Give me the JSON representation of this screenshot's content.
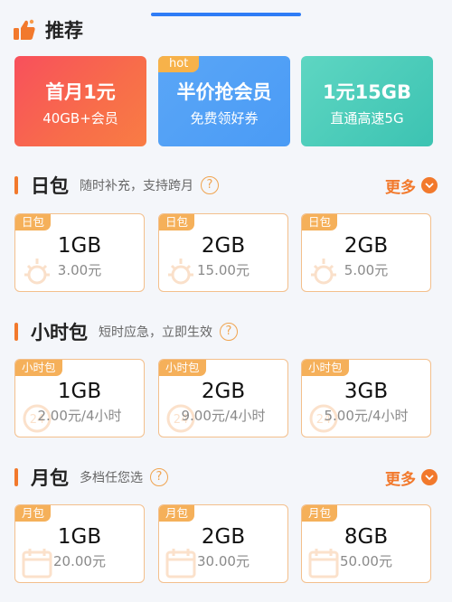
{
  "recommend": {
    "title": "推荐",
    "cards": [
      {
        "main": "首月1元",
        "sub": "40GB+会员"
      },
      {
        "main": "半价抢会员",
        "sub": "免费领好券",
        "tag": "hot"
      },
      {
        "main": "1元15GB",
        "sub": "直通高速5G"
      }
    ]
  },
  "colors": {
    "accent": "#f2792c",
    "tab_indicator": "#2e7cf6"
  },
  "sections": [
    {
      "name": "日包",
      "desc": "随时补充，支持跨月",
      "help": "?",
      "more": "更多",
      "icon": "sun-icon",
      "packages": [
        {
          "tag": "日包",
          "amount": "1GB",
          "price": "3.00元"
        },
        {
          "tag": "日包",
          "amount": "2GB",
          "price": "15.00元"
        },
        {
          "tag": "日包",
          "amount": "2GB",
          "price": "5.00元"
        }
      ]
    },
    {
      "name": "小时包",
      "desc": "短时应急，立即生效",
      "help": "?",
      "icon": "clock-24-icon",
      "packages": [
        {
          "tag": "小时包",
          "amount": "1GB",
          "price": "2.00元/4小时"
        },
        {
          "tag": "小时包",
          "amount": "2GB",
          "price": "9.00元/4小时"
        },
        {
          "tag": "小时包",
          "amount": "3GB",
          "price": "5.00元/4小时"
        }
      ]
    },
    {
      "name": "月包",
      "desc": "多档任您选",
      "help": "?",
      "more": "更多",
      "icon": "calendar-icon",
      "packages": [
        {
          "tag": "月包",
          "amount": "1GB",
          "price": "20.00元"
        },
        {
          "tag": "月包",
          "amount": "2GB",
          "price": "30.00元"
        },
        {
          "tag": "月包",
          "amount": "8GB",
          "price": "50.00元"
        }
      ]
    }
  ]
}
